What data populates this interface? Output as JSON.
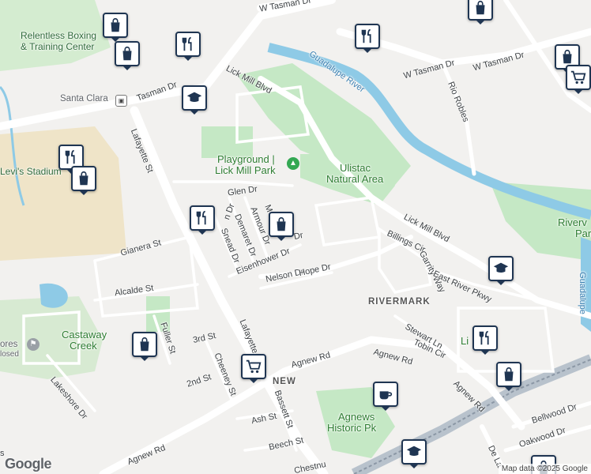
{
  "map": {
    "attribution": "Map data ©2025 Google",
    "logo": "Google"
  },
  "places": {
    "relentless_line1": "Relentless Boxing",
    "relentless_line2": "& Training Center",
    "santa_clara": "Santa Clara",
    "levis_stadium": "Levi's Stadium",
    "playground_line1": "Playground |",
    "playground_line2": "Lick Mill Park",
    "ulistac_line1": "Ulistac",
    "ulistac_line2": "Natural Area",
    "rivermark": "RIVERMARK",
    "castaway_line1": "Castaway",
    "castaway_line2": "Creek",
    "stores": "ores",
    "closed": "losed",
    "agnews_line1": "Agnews",
    "agnews_line2": "Historic Pk",
    "river_park_line1": "Riverv",
    "river_park_line2": "Park",
    "li": "Li",
    "new": "NEW"
  },
  "roads": {
    "w_tasman_top": "W Tasman Dr",
    "w_tasman_right": "W Tasman Dr",
    "tasman": "Tasman Dr",
    "lick_mill_top": "Lick Mill Blvd",
    "lick_mill_right": "Lick Mill Blvd",
    "guadalupe_river": "Guadalupe River",
    "guadalupe_right": "Guadalupe",
    "rio_robles": "Rio Robles",
    "lafayette_st": "Lafayette St",
    "lafayette_low": "Lafayette",
    "glen_dr": "Glen Dr",
    "n_dr": "n Dr",
    "armour": "Armour Dr",
    "demaret": "Demaret Dr",
    "snead": "Snead Dr",
    "m_dr": "M",
    "dr_short": "Dr",
    "eisenhower": "Eisenhower Dr",
    "nelson": "Nelson Dr",
    "hope": "Hope Dr",
    "gianera": "Gianera St",
    "alcalde": "Alcalde St",
    "billings": "Billings Cir",
    "garrity": "Garrity Way",
    "east_river": "East River Pkwy",
    "fuller": "Fuller St",
    "third": "3rd St",
    "second": "2nd St",
    "cheeney": "Cheeney St",
    "lakeshore": "Lakeshore Dr",
    "agnew_mid": "Agnew Rd",
    "agnew_right1": "Agnew Rd",
    "agnew_right2": "Agnew Rd",
    "agnew_left": "Agnew Rd",
    "stewart": "Stewart Ln",
    "tobin": "Tobin Cir",
    "bassett": "Bassett St",
    "ash": "Ash St",
    "beech": "Beech St",
    "chestnut": "Chestnu",
    "bellwood": "Bellwood Dr",
    "oakwood": "Oakwood Dr",
    "de_la": "De La",
    "s_dr": "s"
  },
  "markers": [
    {
      "icon": "shopping-bag-icon"
    },
    {
      "icon": "shopping-bag-icon"
    },
    {
      "icon": "restaurant-icon"
    },
    {
      "icon": "shopping-bag-icon"
    },
    {
      "icon": "restaurant-icon"
    },
    {
      "icon": "shopping-bag-icon"
    },
    {
      "icon": "graduation-cap-icon"
    },
    {
      "icon": "restaurant-icon"
    },
    {
      "icon": "shopping-bag-icon"
    },
    {
      "icon": "restaurant-icon"
    },
    {
      "icon": "shopping-bag-icon"
    },
    {
      "icon": "graduation-cap-icon"
    },
    {
      "icon": "shopping-bag-icon"
    },
    {
      "icon": "shopping-cart-icon"
    },
    {
      "icon": "shopping-cart-icon"
    },
    {
      "icon": "coffee-cup-icon"
    },
    {
      "icon": "restaurant-icon"
    },
    {
      "icon": "shopping-bag-icon"
    },
    {
      "icon": "graduation-cap-icon"
    },
    {
      "icon": "shopping-bag-icon"
    }
  ],
  "colors": {
    "marker_border": "#1f3552",
    "park_green": "#c8e6c9",
    "water_blue": "#8ecae6",
    "road_white": "#ffffff",
    "background": "#f2f1ef"
  }
}
